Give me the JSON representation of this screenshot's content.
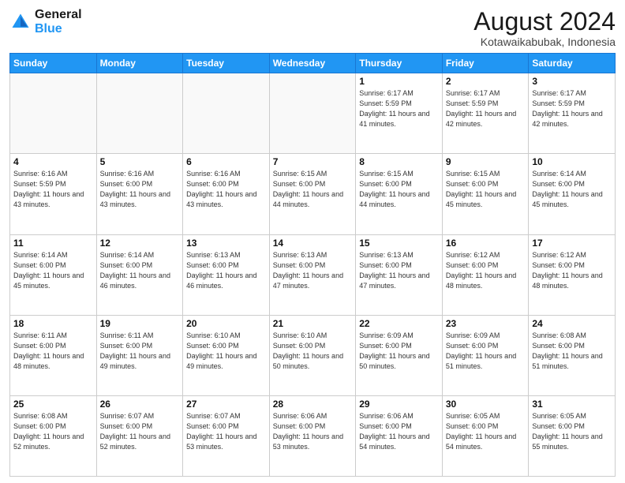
{
  "header": {
    "logo_line1": "General",
    "logo_line2": "Blue",
    "month_title": "August 2024",
    "location": "Kotawaikabubak, Indonesia"
  },
  "days_of_week": [
    "Sunday",
    "Monday",
    "Tuesday",
    "Wednesday",
    "Thursday",
    "Friday",
    "Saturday"
  ],
  "weeks": [
    [
      {
        "day": "",
        "sunrise": "",
        "sunset": "",
        "daylight": ""
      },
      {
        "day": "",
        "sunrise": "",
        "sunset": "",
        "daylight": ""
      },
      {
        "day": "",
        "sunrise": "",
        "sunset": "",
        "daylight": ""
      },
      {
        "day": "",
        "sunrise": "",
        "sunset": "",
        "daylight": ""
      },
      {
        "day": "1",
        "sunrise": "Sunrise: 6:17 AM",
        "sunset": "Sunset: 5:59 PM",
        "daylight": "Daylight: 11 hours and 41 minutes."
      },
      {
        "day": "2",
        "sunrise": "Sunrise: 6:17 AM",
        "sunset": "Sunset: 5:59 PM",
        "daylight": "Daylight: 11 hours and 42 minutes."
      },
      {
        "day": "3",
        "sunrise": "Sunrise: 6:17 AM",
        "sunset": "Sunset: 5:59 PM",
        "daylight": "Daylight: 11 hours and 42 minutes."
      }
    ],
    [
      {
        "day": "4",
        "sunrise": "Sunrise: 6:16 AM",
        "sunset": "Sunset: 5:59 PM",
        "daylight": "Daylight: 11 hours and 43 minutes."
      },
      {
        "day": "5",
        "sunrise": "Sunrise: 6:16 AM",
        "sunset": "Sunset: 6:00 PM",
        "daylight": "Daylight: 11 hours and 43 minutes."
      },
      {
        "day": "6",
        "sunrise": "Sunrise: 6:16 AM",
        "sunset": "Sunset: 6:00 PM",
        "daylight": "Daylight: 11 hours and 43 minutes."
      },
      {
        "day": "7",
        "sunrise": "Sunrise: 6:15 AM",
        "sunset": "Sunset: 6:00 PM",
        "daylight": "Daylight: 11 hours and 44 minutes."
      },
      {
        "day": "8",
        "sunrise": "Sunrise: 6:15 AM",
        "sunset": "Sunset: 6:00 PM",
        "daylight": "Daylight: 11 hours and 44 minutes."
      },
      {
        "day": "9",
        "sunrise": "Sunrise: 6:15 AM",
        "sunset": "Sunset: 6:00 PM",
        "daylight": "Daylight: 11 hours and 45 minutes."
      },
      {
        "day": "10",
        "sunrise": "Sunrise: 6:14 AM",
        "sunset": "Sunset: 6:00 PM",
        "daylight": "Daylight: 11 hours and 45 minutes."
      }
    ],
    [
      {
        "day": "11",
        "sunrise": "Sunrise: 6:14 AM",
        "sunset": "Sunset: 6:00 PM",
        "daylight": "Daylight: 11 hours and 45 minutes."
      },
      {
        "day": "12",
        "sunrise": "Sunrise: 6:14 AM",
        "sunset": "Sunset: 6:00 PM",
        "daylight": "Daylight: 11 hours and 46 minutes."
      },
      {
        "day": "13",
        "sunrise": "Sunrise: 6:13 AM",
        "sunset": "Sunset: 6:00 PM",
        "daylight": "Daylight: 11 hours and 46 minutes."
      },
      {
        "day": "14",
        "sunrise": "Sunrise: 6:13 AM",
        "sunset": "Sunset: 6:00 PM",
        "daylight": "Daylight: 11 hours and 47 minutes."
      },
      {
        "day": "15",
        "sunrise": "Sunrise: 6:13 AM",
        "sunset": "Sunset: 6:00 PM",
        "daylight": "Daylight: 11 hours and 47 minutes."
      },
      {
        "day": "16",
        "sunrise": "Sunrise: 6:12 AM",
        "sunset": "Sunset: 6:00 PM",
        "daylight": "Daylight: 11 hours and 48 minutes."
      },
      {
        "day": "17",
        "sunrise": "Sunrise: 6:12 AM",
        "sunset": "Sunset: 6:00 PM",
        "daylight": "Daylight: 11 hours and 48 minutes."
      }
    ],
    [
      {
        "day": "18",
        "sunrise": "Sunrise: 6:11 AM",
        "sunset": "Sunset: 6:00 PM",
        "daylight": "Daylight: 11 hours and 48 minutes."
      },
      {
        "day": "19",
        "sunrise": "Sunrise: 6:11 AM",
        "sunset": "Sunset: 6:00 PM",
        "daylight": "Daylight: 11 hours and 49 minutes."
      },
      {
        "day": "20",
        "sunrise": "Sunrise: 6:10 AM",
        "sunset": "Sunset: 6:00 PM",
        "daylight": "Daylight: 11 hours and 49 minutes."
      },
      {
        "day": "21",
        "sunrise": "Sunrise: 6:10 AM",
        "sunset": "Sunset: 6:00 PM",
        "daylight": "Daylight: 11 hours and 50 minutes."
      },
      {
        "day": "22",
        "sunrise": "Sunrise: 6:09 AM",
        "sunset": "Sunset: 6:00 PM",
        "daylight": "Daylight: 11 hours and 50 minutes."
      },
      {
        "day": "23",
        "sunrise": "Sunrise: 6:09 AM",
        "sunset": "Sunset: 6:00 PM",
        "daylight": "Daylight: 11 hours and 51 minutes."
      },
      {
        "day": "24",
        "sunrise": "Sunrise: 6:08 AM",
        "sunset": "Sunset: 6:00 PM",
        "daylight": "Daylight: 11 hours and 51 minutes."
      }
    ],
    [
      {
        "day": "25",
        "sunrise": "Sunrise: 6:08 AM",
        "sunset": "Sunset: 6:00 PM",
        "daylight": "Daylight: 11 hours and 52 minutes."
      },
      {
        "day": "26",
        "sunrise": "Sunrise: 6:07 AM",
        "sunset": "Sunset: 6:00 PM",
        "daylight": "Daylight: 11 hours and 52 minutes."
      },
      {
        "day": "27",
        "sunrise": "Sunrise: 6:07 AM",
        "sunset": "Sunset: 6:00 PM",
        "daylight": "Daylight: 11 hours and 53 minutes."
      },
      {
        "day": "28",
        "sunrise": "Sunrise: 6:06 AM",
        "sunset": "Sunset: 6:00 PM",
        "daylight": "Daylight: 11 hours and 53 minutes."
      },
      {
        "day": "29",
        "sunrise": "Sunrise: 6:06 AM",
        "sunset": "Sunset: 6:00 PM",
        "daylight": "Daylight: 11 hours and 54 minutes."
      },
      {
        "day": "30",
        "sunrise": "Sunrise: 6:05 AM",
        "sunset": "Sunset: 6:00 PM",
        "daylight": "Daylight: 11 hours and 54 minutes."
      },
      {
        "day": "31",
        "sunrise": "Sunrise: 6:05 AM",
        "sunset": "Sunset: 6:00 PM",
        "daylight": "Daylight: 11 hours and 55 minutes."
      }
    ]
  ]
}
